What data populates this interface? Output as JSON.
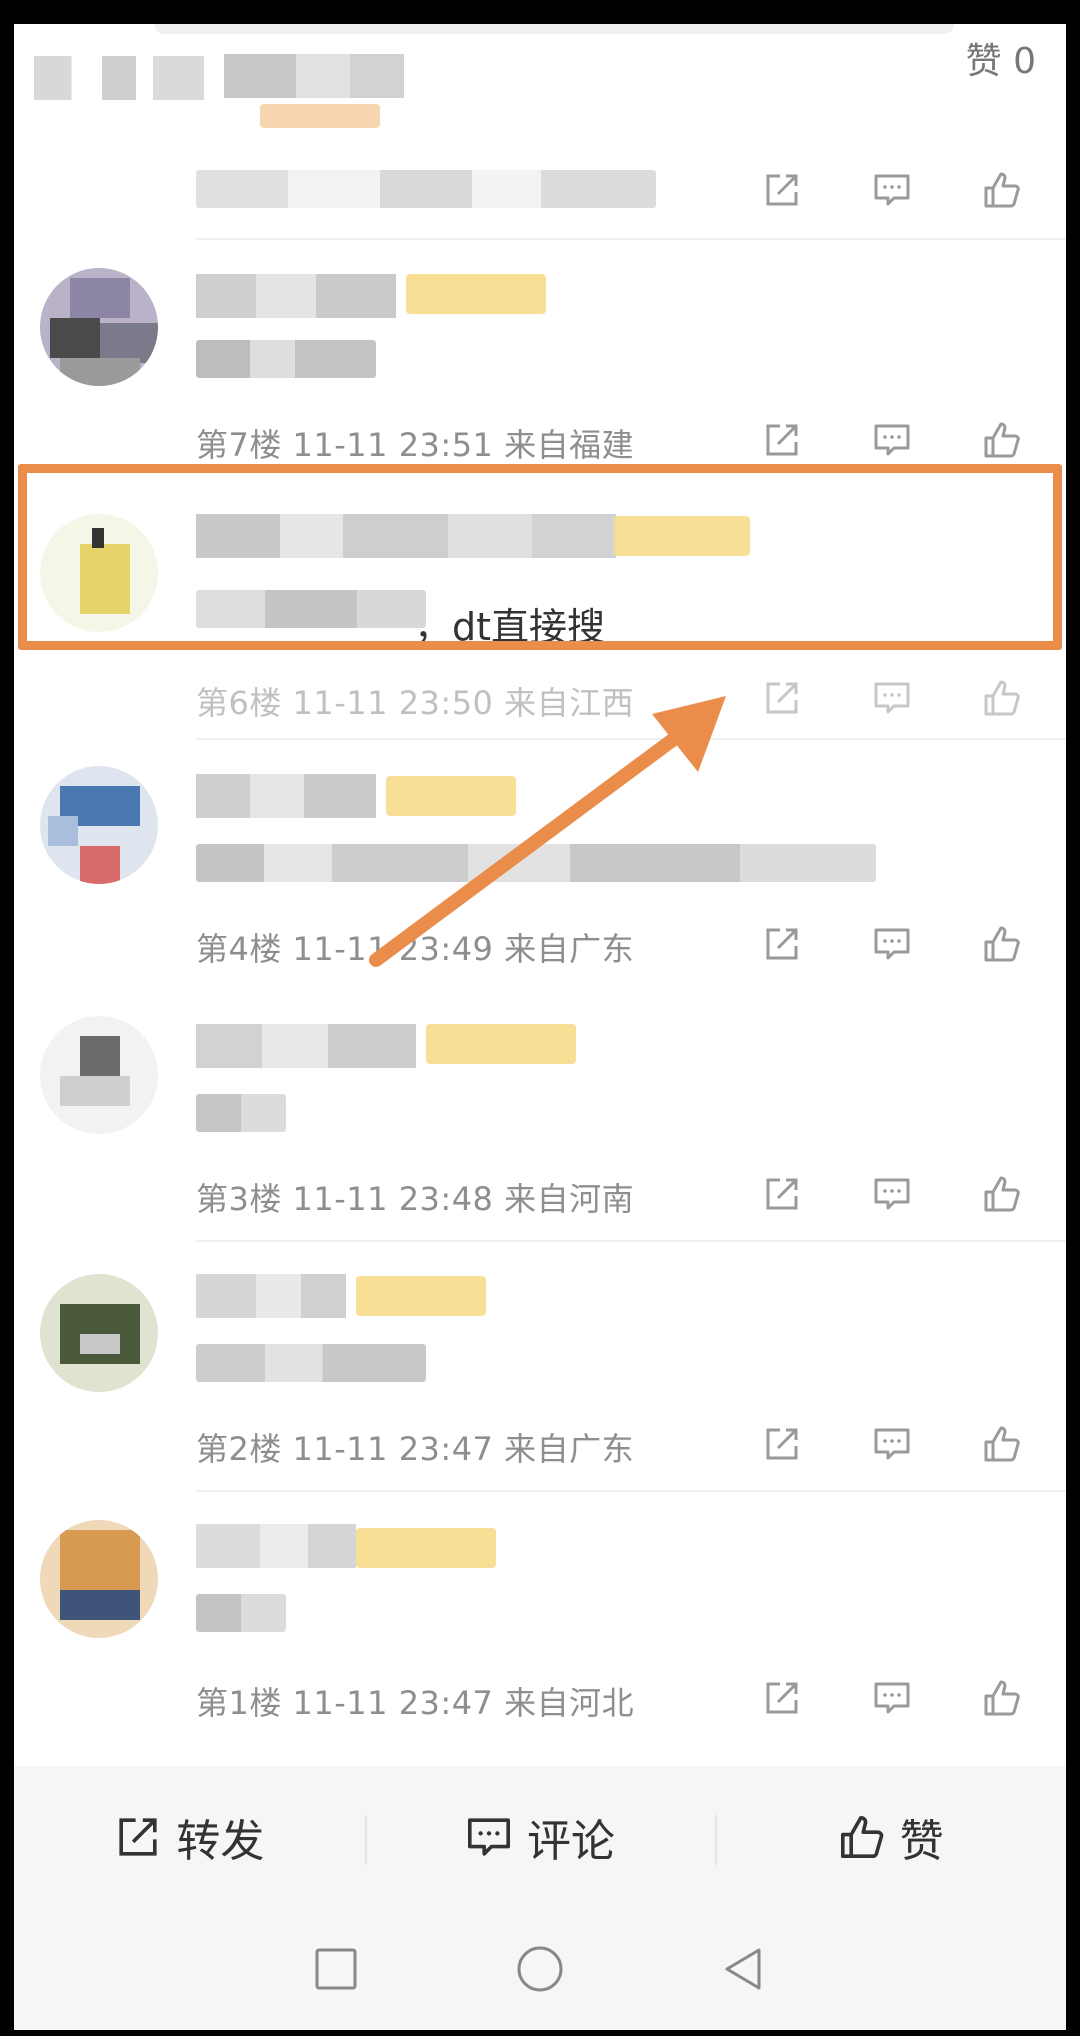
{
  "top_like": "赞 0",
  "comments": [
    {
      "meta": "第7楼 11-11 23:51 来自福建"
    },
    {
      "meta": "第6楼 11-11 23:50 来自江西",
      "snippet": "，dt直接搜"
    },
    {
      "meta": "第4楼 11-11 23:49 来自广东"
    },
    {
      "meta": "第3楼 11-11 23:48 来自河南"
    },
    {
      "meta": "第2楼 11-11 23:47 来自广东"
    },
    {
      "meta": "第1楼 11-11 23:47 来自河北"
    }
  ],
  "bottom_bar": {
    "repost": "转发",
    "comment": "评论",
    "like": "赞"
  },
  "colors": {
    "highlight": "#ea8d4a",
    "meta_text": "#8e8e8e",
    "tag": "#f7dc8a"
  },
  "icons": [
    "share-icon",
    "comment-icon",
    "thumb-up-icon",
    "home-square-icon",
    "circle-home-icon",
    "back-triangle-icon"
  ]
}
